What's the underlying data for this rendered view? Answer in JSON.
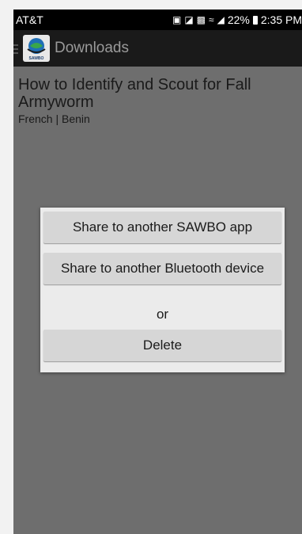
{
  "status_bar": {
    "carrier": "AT&T",
    "battery_percent": "22%",
    "time": "2:35 PM",
    "icons": [
      "save-icon",
      "nfc-icon",
      "vibrate-icon",
      "wifi-icon",
      "signal-icon",
      "battery-icon"
    ]
  },
  "app_bar": {
    "title": "Downloads"
  },
  "download_item": {
    "title": "How to Identify and Scout for Fall Armyworm",
    "subtitle": "French | Benin"
  },
  "dialog": {
    "share_app_label": "Share to another SAWBO app",
    "share_bluetooth_label": "Share to another Bluetooth device",
    "or_label": "or",
    "delete_label": "Delete"
  }
}
